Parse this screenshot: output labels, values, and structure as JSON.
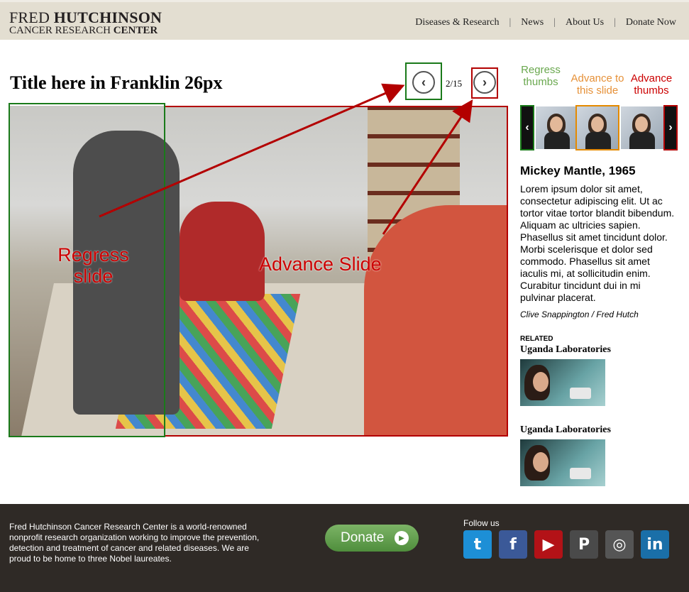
{
  "header": {
    "logo_line1_regular": "FRED ",
    "logo_line1_bold": "HUTCHINSON",
    "logo_line2_regular": "CANCER RESEARCH ",
    "logo_line2_bold": "CENTER",
    "nav": [
      "Diseases & Research",
      "News",
      "About Us",
      "Donate Now"
    ],
    "nav_separator": "|"
  },
  "slideshow": {
    "title": "Title here in Franklin 26px",
    "counter": "2/15",
    "prev_symbol": "‹",
    "next_symbol": "›"
  },
  "annotations": {
    "regress_slide": "Regress slide",
    "advance_slide": "Advance Slide",
    "regress_thumbs": "Regress thumbs",
    "advance_to_slide": "Advance to this slide",
    "advance_thumbs": "Advance thumbs",
    "colors": {
      "green": "#1a7a1a",
      "red": "#b30000",
      "orange": "#e58a00",
      "green_label": "#6aa84f",
      "red_label": "#cc0000",
      "orange_label": "#e69138"
    }
  },
  "thumbs": {
    "prev_symbol": "‹",
    "next_symbol": "›"
  },
  "caption": {
    "title": "Mickey Mantle, 1965",
    "body": "Lorem ipsum dolor sit amet, consectetur adipiscing elit. Ut ac tortor vitae tortor blandit bibendum. Aliquam ac ultricies sapien. Phasellus sit amet tincidunt dolor. Morbi scelerisque et dolor sed commodo. Phasellus sit amet iaculis mi, at sollicitudin enim. Curabitur tincidunt dui in mi pulvinar placerat.",
    "credit": "Clive Snappington / Fred Hutch"
  },
  "related": {
    "label": "RELATED",
    "items": [
      {
        "title": "Uganda Laboratories"
      },
      {
        "title": "Uganda Laboratories"
      }
    ]
  },
  "footer": {
    "text": "Fred Hutchinson Cancer Research Center is a world-renowned nonprofit research organization working to improve the prevention, detection and treatment of cancer and related diseases. We are proud to be home to three Nobel laureates.",
    "donate_label": "Donate",
    "follow_label": "Follow us",
    "social": [
      {
        "name": "twitter-icon",
        "glyph": "t",
        "color": "#1d8fd6"
      },
      {
        "name": "facebook-icon",
        "glyph": "f",
        "color": "#3b5998"
      },
      {
        "name": "youtube-icon",
        "glyph": "▶",
        "color": "#b31217"
      },
      {
        "name": "pinterest-icon",
        "glyph": "P",
        "color": "#4a4a4a"
      },
      {
        "name": "instagram-icon",
        "glyph": "◎",
        "color": "#555555"
      },
      {
        "name": "linkedin-icon",
        "glyph": "in",
        "color": "#1a6fa8"
      }
    ]
  }
}
